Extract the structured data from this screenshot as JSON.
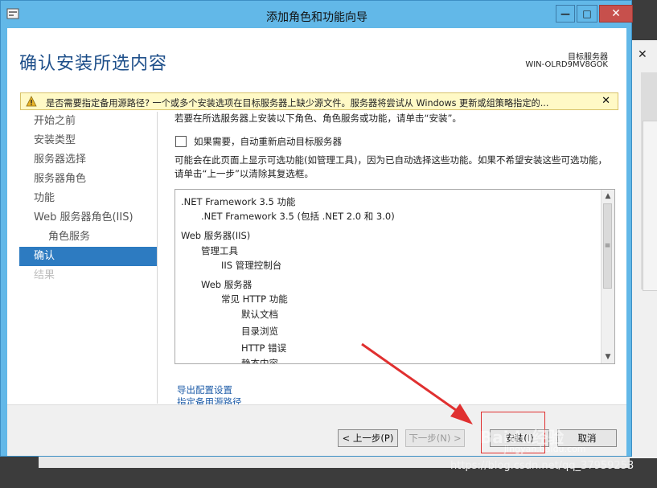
{
  "window": {
    "title": "添加角色和功能向导",
    "minimize": "—",
    "maximize": "□",
    "close": "✕"
  },
  "header": {
    "title": "确认安装所选内容",
    "target_label": "目标服务器",
    "target_value": "WIN-OLRD9MV8GOK"
  },
  "warning": {
    "text": "是否需要指定备用源路径? 一个或多个安装选项在目标服务器上缺少源文件。服务器将尝试从 Windows 更新或组策略指定的...",
    "close": "✕"
  },
  "nav": {
    "items": [
      {
        "label": "开始之前"
      },
      {
        "label": "安装类型"
      },
      {
        "label": "服务器选择"
      },
      {
        "label": "服务器角色"
      },
      {
        "label": "功能"
      },
      {
        "label": "Web 服务器角色(IIS)"
      },
      {
        "label": "角色服务"
      },
      {
        "label": "确认"
      },
      {
        "label": "结果"
      }
    ]
  },
  "content": {
    "intro": "若要在所选服务器上安装以下角色、角色服务或功能，请单击“安装”。",
    "restart_checkbox_label": "如果需要，自动重新启动目标服务器",
    "restart_checked": false,
    "paragraph": "可能会在此页面上显示可选功能(如管理工具)，因为已自动选择这些功能。如果不希望安装这些可选功能，请单击“上一步”以清除其复选框。",
    "features": [
      {
        "label": ".NET Framework 3.5 功能"
      },
      {
        "label": ".NET Framework 3.5 (包括 .NET 2.0 和 3.0)"
      },
      {
        "label": "Web 服务器(IIS)"
      },
      {
        "label": "管理工具"
      },
      {
        "label": "IIS 管理控制台"
      },
      {
        "label": "Web 服务器"
      },
      {
        "label": "常见 HTTP 功能"
      },
      {
        "label": "默认文档"
      },
      {
        "label": "目录浏览"
      },
      {
        "label": "HTTP 错误"
      },
      {
        "label": "静态内容"
      }
    ],
    "export_link": "导出配置设置",
    "alt_source_link": "指定备用源路径"
  },
  "footer": {
    "prev": "< 上一步(P)",
    "next": "下一步(N) >",
    "install": "安装(I)",
    "cancel": "取消"
  },
  "watermark": {
    "url": "jingyan.baidu.com",
    "blog": "https://blog.csdn.net/qq_37959253",
    "brand": "Baidu经验"
  },
  "colors": {
    "titlebar": "#62b8e8",
    "close_button": "#c7504c",
    "nav_active": "#2d7bc1",
    "header_text": "#1e4f8a",
    "warning_bg": "#fff9c6",
    "annotation": "#e03030"
  }
}
